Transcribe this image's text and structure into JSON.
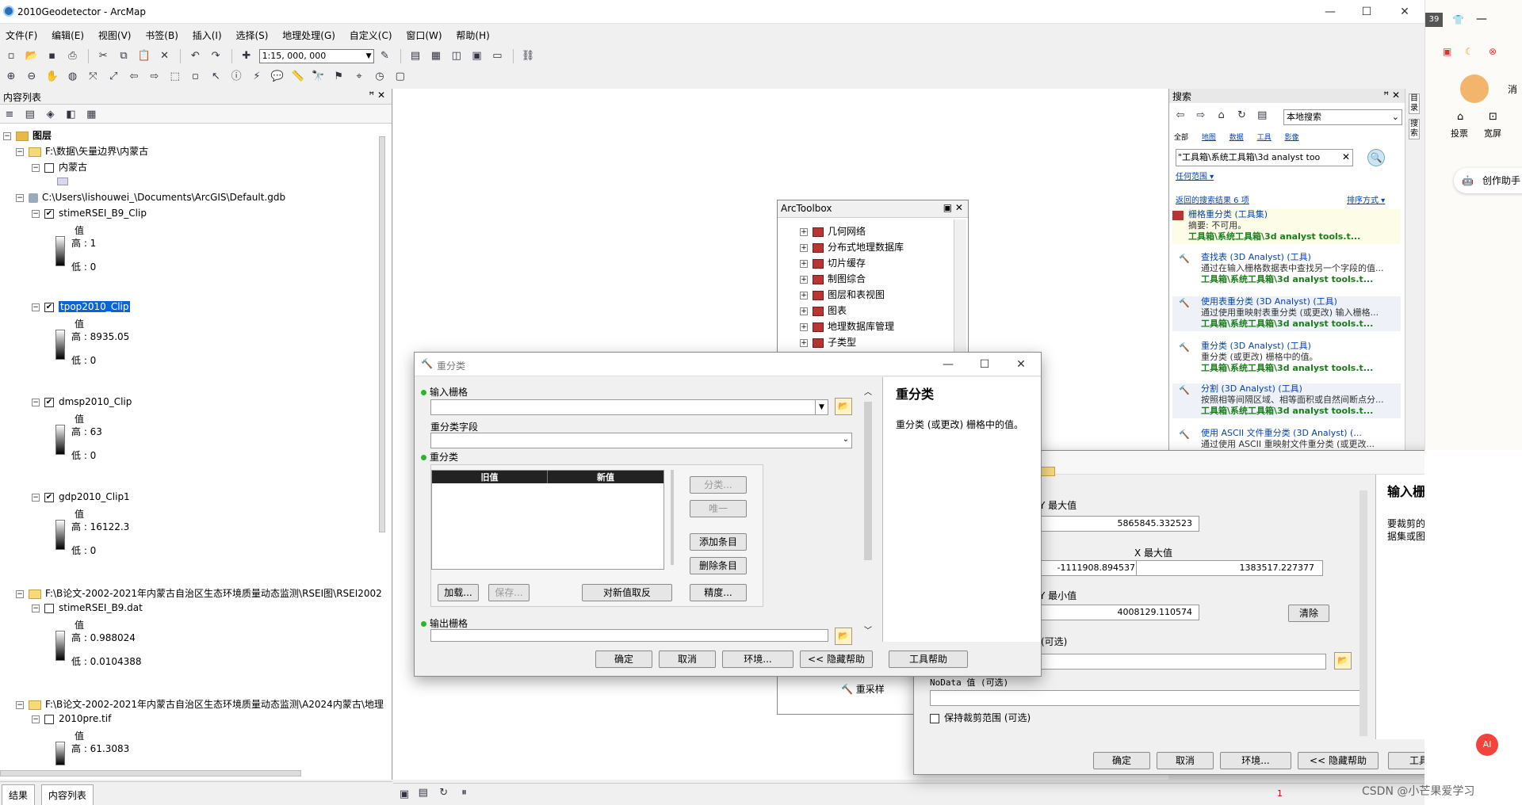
{
  "window": {
    "title": "2010Geodetector - ArcMap",
    "controls": {
      "minimize": "—",
      "maximize": "☐",
      "close": "✕"
    }
  },
  "menu": [
    "文件(F)",
    "编辑(E)",
    "视图(V)",
    "书签(B)",
    "插入(I)",
    "选择(S)",
    "地理处理(G)",
    "自定义(C)",
    "窗口(W)",
    "帮助(H)"
  ],
  "toolbar": {
    "scale": "1:15, 000, 000"
  },
  "toc": {
    "title": "内容列表",
    "root": "图层",
    "groups": [
      {
        "path": "F:\\数据\\矢量边界\\内蒙古",
        "layers": [
          {
            "name": "内蒙古"
          }
        ]
      },
      {
        "path": "C:\\Users\\lishouwei_\\Documents\\ArcGIS\\Default.gdb",
        "layers": [
          {
            "name": "stimeRSEI_B9_Clip",
            "value_label": "值",
            "high": "高 : 1",
            "low": "低 : 0"
          },
          {
            "name": "tpop2010_Clip",
            "value_label": "值",
            "high": "高 : 8935.05",
            "low": "低 : 0"
          },
          {
            "name": "dmsp2010_Clip",
            "value_label": "值",
            "high": "高 : 63",
            "low": "低 : 0"
          },
          {
            "name": "gdp2010_Clip1",
            "value_label": "值",
            "high": "高 : 16122.3",
            "low": "低 : 0"
          }
        ]
      },
      {
        "path": "F:\\B论文-2002-2021年内蒙古自治区生态环境质量动态监测\\RSEI图\\RSEI2002",
        "layers": [
          {
            "name": "stimeRSEI_B9.dat",
            "value_label": "值",
            "high": "高 : 0.988024",
            "low": "低 : 0.0104388"
          }
        ]
      },
      {
        "path": "F:\\B论文-2002-2021年内蒙古自治区生态环境质量动态监测\\A2024内蒙古\\地理",
        "layers": [
          {
            "name": "2010pre.tif",
            "value_label": "值",
            "high": "高 : 61.3083"
          }
        ]
      }
    ],
    "tabs": [
      "结果",
      "内容列表"
    ]
  },
  "search": {
    "title": "搜索",
    "scope": "本地搜索",
    "filters": [
      "全部",
      "地图",
      "数据",
      "工具",
      "影像"
    ],
    "query": "\"工具箱\\系统工具箱\\3d analyst too",
    "extent": "任何范围",
    "return_info": "返回的搜索结果 6 项",
    "sort": "排序方式",
    "results": [
      {
        "title": "栅格重分类 (工具集)",
        "desc": "摘要: 不可用。",
        "path": "工具箱\\系统工具箱\\3d analyst tools.t..."
      },
      {
        "title": "查找表 (3D Analyst) (工具)",
        "desc": "通过在输入栅格数据表中查找另一个字段的值...",
        "path": "工具箱\\系统工具箱\\3d analyst tools.t..."
      },
      {
        "title": "使用表重分类 (3D Analyst) (工具)",
        "desc": "通过使用重映射表重分类 (或更改) 输入栅格...",
        "path": "工具箱\\系统工具箱\\3d analyst tools.t..."
      },
      {
        "title": "重分类 (3D Analyst) (工具)",
        "desc": "重分类 (或更改) 栅格中的值。",
        "path": "工具箱\\系统工具箱\\3d analyst tools.t..."
      },
      {
        "title": "分割 (3D Analyst) (工具)",
        "desc": "按照相等间隔区域、相等面积或自然间断点分...",
        "path": "工具箱\\系统工具箱\\3d analyst tools.t..."
      },
      {
        "title": "使用 ASCII 文件重分类 (3D Analyst) (...",
        "desc": "通过使用 ASCII 重映射文件重分类 (或更改...",
        "path": ""
      }
    ]
  },
  "rstrip": [
    "目录",
    "搜索"
  ],
  "arctoolbox": {
    "title": "ArcToolbox",
    "items": [
      "几何网络",
      "分布式地理数据库",
      "切片缓存",
      "制图综合",
      "图层和表视图",
      "图表",
      "地理数据库管理",
      "子类型"
    ],
    "bottom_item": "重采样"
  },
  "reclass_dialog": {
    "title": "重分类",
    "input_raster": "输入栅格",
    "reclass_field": "重分类字段",
    "reclassification": "重分类",
    "col_old": "旧值",
    "col_new": "新值",
    "btn_classify": "分类...",
    "btn_unique": "唯一",
    "btn_add": "添加条目",
    "btn_delete": "删除条目",
    "btn_load": "加载...",
    "btn_save": "保存...",
    "btn_reverse": "对新值取反",
    "btn_precision": "精度...",
    "output_raster": "输出栅格",
    "ok": "确定",
    "cancel": "取消",
    "env": "环境...",
    "hide_help": "<< 隐藏帮助",
    "tool_help": "工具帮助",
    "help_title": "重分类",
    "help_text": "重分类 (或更改) 栅格中的值。"
  },
  "clip_dialog": {
    "ymax_label": "Y 最大值",
    "ymax": "5865845.332523",
    "xmin": "-1111908.894537",
    "xmax_label": "X 最大值",
    "xmax": "1383517.227377",
    "ymin_label": "Y 最小值",
    "ymin": "4008129.110574",
    "clear": "清除",
    "optional": "(可选)",
    "nodata": "NoData 值 (可选)",
    "keep_extent": "保持裁剪范围 (可选)",
    "ok": "确定",
    "cancel": "取消",
    "env": "环境...",
    "hide_help": "<< 隐藏帮助",
    "tool_help": "工具帮助",
    "help_title": "输入栅格",
    "help_text": "要裁剪的栅格数据集、镶嵌数据集或图象服务。"
  },
  "side_app": {
    "tab_count": "39",
    "btn1": "投票",
    "btn2": "宽屏",
    "assistant": "创作助手",
    "msg": "消",
    "watermark": "CSDN @小芒果爱学习"
  },
  "status": {
    "page": "1"
  }
}
